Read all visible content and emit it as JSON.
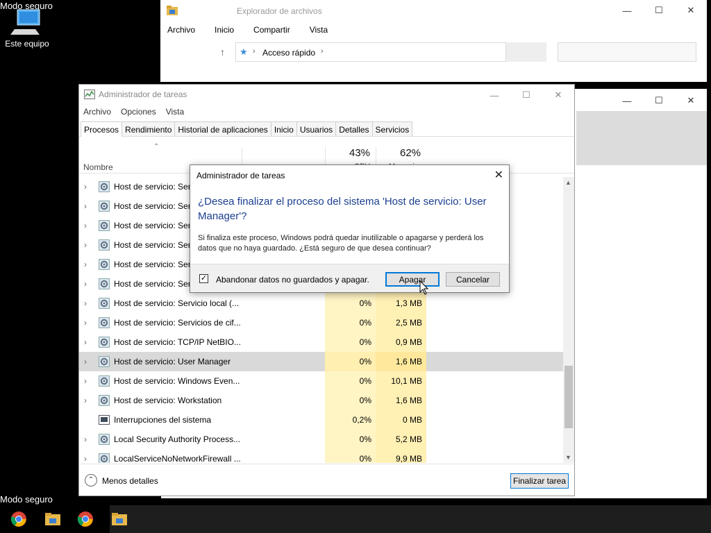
{
  "desktop": {
    "safe_mode_top": "Modo seguro",
    "safe_mode_bottom": "Modo seguro",
    "icon_label": "Este equipo"
  },
  "explorer": {
    "title": "Explorador de archivos",
    "ribbon": [
      "Archivo",
      "Inicio",
      "Compartir",
      "Vista"
    ],
    "breadcrumb": "Acceso rápido"
  },
  "taskmgr": {
    "title": "Administrador de tareas",
    "menu": [
      "Archivo",
      "Opciones",
      "Vista"
    ],
    "tabs": [
      "Procesos",
      "Rendimiento",
      "Historial de aplicaciones",
      "Inicio",
      "Usuarios",
      "Detalles",
      "Servicios"
    ],
    "active_tab": "Procesos",
    "col_name": "Nombre",
    "cpu_pct": "43%",
    "cpu_label": "CPU",
    "mem_pct": "62%",
    "mem_label": "Memoria",
    "rows": [
      {
        "name": "Host de servicio: Serv",
        "cpu": "",
        "mem": "",
        "expand": true
      },
      {
        "name": "Host de servicio: Serv",
        "cpu": "",
        "mem": "",
        "expand": true
      },
      {
        "name": "Host de servicio: Serv",
        "cpu": "",
        "mem": "",
        "expand": true
      },
      {
        "name": "Host de servicio: Serv",
        "cpu": "",
        "mem": "",
        "expand": true
      },
      {
        "name": "Host de servicio: Serv",
        "cpu": "",
        "mem": "",
        "expand": true
      },
      {
        "name": "Host de servicio: Serv",
        "cpu": "",
        "mem": "",
        "expand": true
      },
      {
        "name": "Host de servicio: Servicio local (...",
        "cpu": "0%",
        "mem": "1,3 MB",
        "expand": true
      },
      {
        "name": "Host de servicio: Servicios de cif...",
        "cpu": "0%",
        "mem": "2,5 MB",
        "expand": true
      },
      {
        "name": "Host de servicio: TCP/IP NetBIO...",
        "cpu": "0%",
        "mem": "0,9 MB",
        "expand": true
      },
      {
        "name": "Host de servicio: User Manager",
        "cpu": "0%",
        "mem": "1,6 MB",
        "expand": true,
        "selected": true
      },
      {
        "name": "Host de servicio: Windows Even...",
        "cpu": "0%",
        "mem": "10,1 MB",
        "expand": true
      },
      {
        "name": "Host de servicio: Workstation",
        "cpu": "0%",
        "mem": "1,6 MB",
        "expand": true
      },
      {
        "name": "Interrupciones del sistema",
        "cpu": "0,2%",
        "mem": "0 MB",
        "expand": false
      },
      {
        "name": "Local Security Authority Process...",
        "cpu": "0%",
        "mem": "5,2 MB",
        "expand": true
      },
      {
        "name": "LocalServiceNoNetworkFirewall ...",
        "cpu": "0%",
        "mem": "9,9 MB",
        "expand": true
      }
    ],
    "less_details": "Menos detalles",
    "end_task": "Finalizar tarea"
  },
  "dialog": {
    "title": "Administrador de tareas",
    "heading": "¿Desea finalizar el proceso del sistema 'Host de servicio: User Manager'?",
    "body": "Si finaliza este proceso, Windows podrá quedar inutilizable o apagarse y perderá los datos que no haya guardado. ¿Está seguro de que desea continuar?",
    "checkbox_label": "Abandonar datos no guardados y apagar.",
    "checked": true,
    "confirm": "Apagar",
    "cancel": "Cancelar"
  },
  "colors": {
    "accent": "#0078d7",
    "heading": "#1a3e91",
    "cpu_cell": "#fff4c4",
    "mem_cell": "#fff0b4"
  }
}
